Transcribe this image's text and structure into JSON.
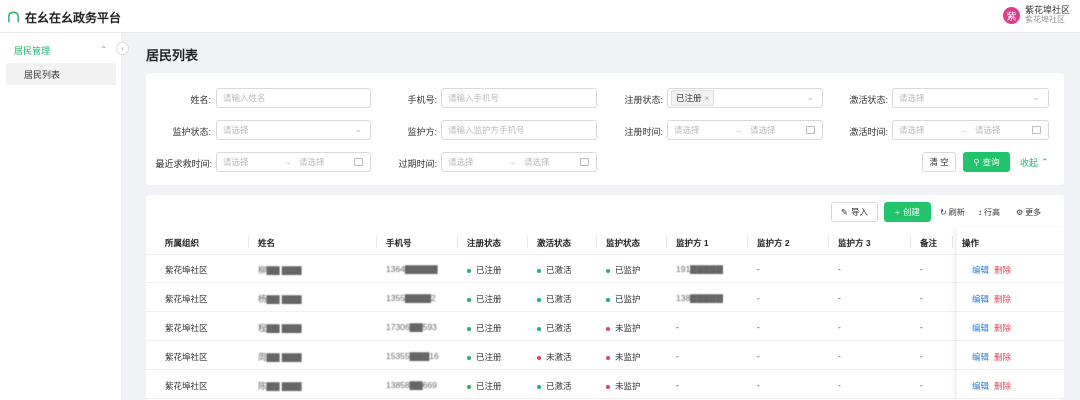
{
  "app": {
    "title": "在幺在幺政务平台"
  },
  "user": {
    "avatar_char": "紫",
    "name": "紫花埠社区",
    "org": "紫花埠社区"
  },
  "sidebar": {
    "group_label": "居民管理",
    "items": [
      {
        "label": "居民列表",
        "active": true
      }
    ]
  },
  "page": {
    "title": "居民列表"
  },
  "filters": {
    "name": {
      "label": "姓名:",
      "placeholder": "请输入姓名"
    },
    "phone": {
      "label": "手机号:",
      "placeholder": "请输入手机号"
    },
    "reg_status": {
      "label": "注册状态:",
      "tag": "已注册"
    },
    "act_status": {
      "label": "激活状态:",
      "placeholder": "请选择"
    },
    "monitor_status": {
      "label": "监护状态:",
      "placeholder": "请选择"
    },
    "guardian": {
      "label": "监护方:",
      "placeholder": "请输入监护方手机号"
    },
    "reg_time": {
      "label": "注册时间:",
      "start": "请选择",
      "end": "请选择"
    },
    "act_time": {
      "label": "激活时间:",
      "start": "请选择",
      "end": "请选择"
    },
    "sos_time": {
      "label": "最近求救时间:",
      "start": "请选择",
      "end": "请选择"
    },
    "expire_time": {
      "label": "过期时间:",
      "start": "请选择",
      "end": "请选择"
    },
    "clear_label": "清 空",
    "query_label": "查询",
    "collapse_label": "收起"
  },
  "toolbar": {
    "import_label": "导入",
    "create_label": "创建",
    "refresh_label": "刷新",
    "rowheight_label": "行高",
    "more_label": "更多"
  },
  "table": {
    "columns": [
      "所属组织",
      "姓名",
      "手机号",
      "注册状态",
      "激活状态",
      "监护状态",
      "监护方 1",
      "监护方 2",
      "监护方 3",
      "备注",
      "操作"
    ],
    "edit_label": "编辑",
    "delete_label": "删除",
    "rows": [
      {
        "org": "紫花埠社区",
        "name": "柳▇▇ ▇▇▇",
        "phone": "1364▇▇▇▇▇",
        "reg": "已注册",
        "act": "已激活",
        "mon": "已监护",
        "g1": "191▇▇▇▇▇",
        "g2": "-",
        "g3": "-",
        "note": "-"
      },
      {
        "org": "紫花埠社区",
        "name": "杨▇▇ ▇▇▇",
        "phone": "1355▇▇▇▇2",
        "reg": "已注册",
        "act": "已激活",
        "mon": "已监护",
        "g1": "138▇▇▇▇▇",
        "g2": "-",
        "g3": "-",
        "note": "-"
      },
      {
        "org": "紫花埠社区",
        "name": "程▇▇ ▇▇▇",
        "phone": "17306▇▇593",
        "reg": "已注册",
        "act": "已激活",
        "mon": "未监护",
        "g1": "-",
        "g2": "-",
        "g3": "-",
        "note": "-"
      },
      {
        "org": "紫花埠社区",
        "name": "周▇▇ ▇▇▇",
        "phone": "15355▇▇▇16",
        "reg": "已注册",
        "act": "未激活",
        "mon": "未监护",
        "g1": "-",
        "g2": "-",
        "g3": "-",
        "note": "-"
      },
      {
        "org": "紫花埠社区",
        "name": "陈▇▇ ▇▇▇",
        "phone": "13858▇▇669",
        "reg": "已注册",
        "act": "已激活",
        "mon": "未监护",
        "g1": "-",
        "g2": "-",
        "g3": "-",
        "note": "-"
      }
    ]
  },
  "colors": {
    "accent": "#21c36b",
    "ok": "#21b36b",
    "bad": "#e0455a",
    "link": "#2a7bd6"
  }
}
